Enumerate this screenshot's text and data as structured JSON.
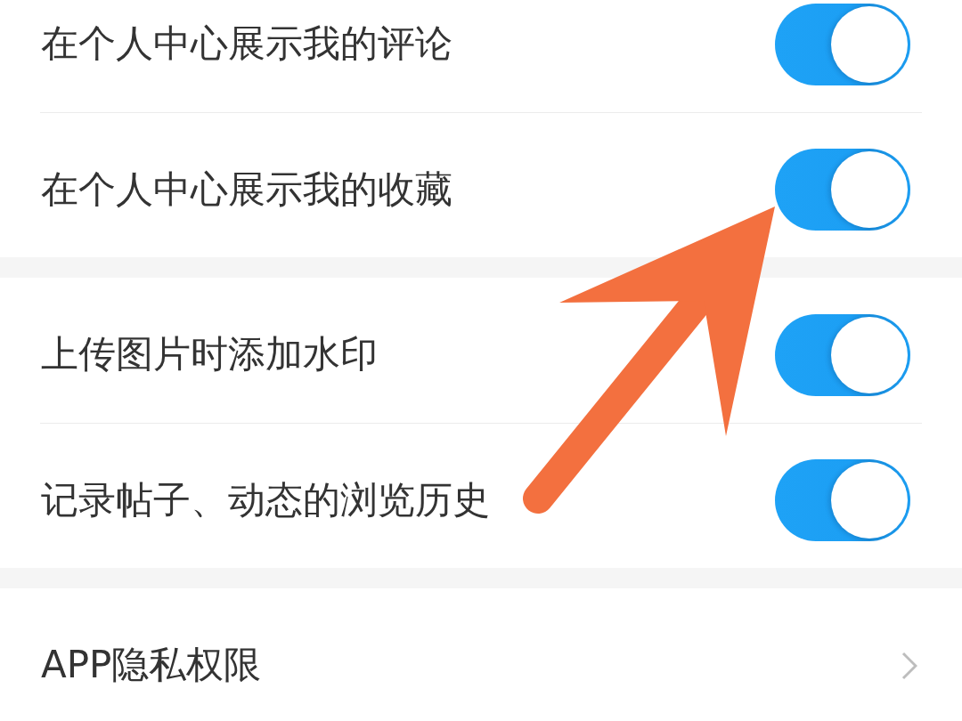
{
  "sections": [
    {
      "rows": [
        {
          "kind": "toggle",
          "label": "在个人中心展示我的评论",
          "on": true
        },
        {
          "kind": "toggle",
          "label": "在个人中心展示我的收藏",
          "on": true
        }
      ]
    },
    {
      "rows": [
        {
          "kind": "toggle",
          "label": "上传图片时添加水印",
          "on": true
        },
        {
          "kind": "toggle",
          "label": "记录帖子、动态的浏览历史",
          "on": true
        }
      ]
    },
    {
      "rows": [
        {
          "kind": "link",
          "label": "APP隐私权限"
        }
      ]
    }
  ],
  "annotation": {
    "kind": "arrow"
  }
}
